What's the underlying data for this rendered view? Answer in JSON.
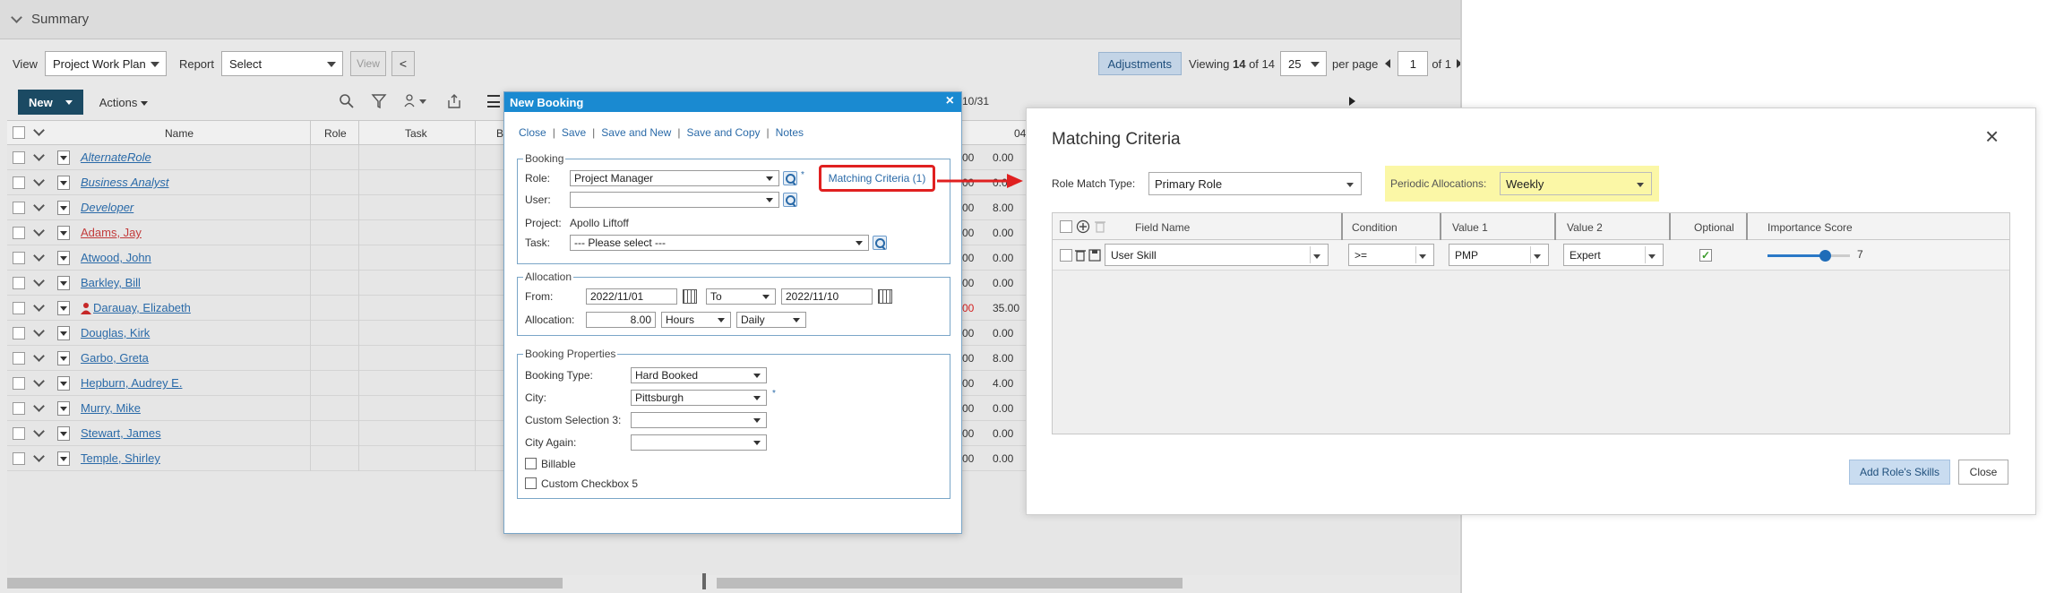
{
  "summary": {
    "label": "Summary"
  },
  "toolbar": {
    "view_label": "View",
    "view_value": "Project Work Plan",
    "report_label": "Report",
    "report_value": "Select",
    "view_button": "View",
    "adjustments": "Adjustments",
    "viewing_prefix": "Viewing",
    "viewing_count": "14",
    "viewing_of": "of 14",
    "per_page_value": "25",
    "per_page_label": "per page",
    "page_value": "1",
    "page_of": "of 1"
  },
  "toolbar2": {
    "new_label": "New",
    "actions_label": "Actions",
    "date_fragment": "10/31"
  },
  "grid": {
    "columns": {
      "name": "Name",
      "role": "Role",
      "task": "Task",
      "b": "B",
      "date": "04"
    },
    "rows": [
      {
        "name": "AlternateRole",
        "italic": true,
        "color": "#2a6aa8",
        "v1": "00",
        "v2": "0.00",
        "v1color": "#333",
        "user_icon": false
      },
      {
        "name": "Business Analyst",
        "italic": true,
        "color": "#2a6aa8",
        "v1": "00",
        "v2": "0.00",
        "v1color": "#333",
        "user_icon": false
      },
      {
        "name": "Developer",
        "italic": true,
        "color": "#2a6aa8",
        "v1": "00",
        "v2": "8.00",
        "v1color": "#333",
        "user_icon": false
      },
      {
        "name": "Adams, Jay",
        "italic": false,
        "color": "#c23b3b",
        "v1": "00",
        "v2": "0.00",
        "v1color": "#333",
        "user_icon": false
      },
      {
        "name": "Atwood, John",
        "italic": false,
        "color": "#2a6aa8",
        "v1": "00",
        "v2": "0.00",
        "v1color": "#333",
        "user_icon": false
      },
      {
        "name": "Barkley, Bill",
        "italic": false,
        "color": "#2a6aa8",
        "v1": "00",
        "v2": "0.00",
        "v1color": "#333",
        "user_icon": false
      },
      {
        "name": "Darauay, Elizabeth",
        "italic": false,
        "color": "#2a6aa8",
        "v1": "00",
        "v2": "35.00",
        "v1color": "#d42020",
        "user_icon": true
      },
      {
        "name": "Douglas, Kirk",
        "italic": false,
        "color": "#2a6aa8",
        "v1": "00",
        "v2": "0.00",
        "v1color": "#333",
        "user_icon": false
      },
      {
        "name": "Garbo, Greta",
        "italic": false,
        "color": "#2a6aa8",
        "v1": "00",
        "v2": "8.00",
        "v1color": "#333",
        "user_icon": false
      },
      {
        "name": "Hepburn, Audrey E.",
        "italic": false,
        "color": "#2a6aa8",
        "v1": "00",
        "v2": "4.00",
        "v1color": "#333",
        "user_icon": false
      },
      {
        "name": "Murry, Mike",
        "italic": false,
        "color": "#2a6aa8",
        "v1": "00",
        "v2": "0.00",
        "v1color": "#333",
        "user_icon": false
      },
      {
        "name": "Stewart, James",
        "italic": false,
        "color": "#2a6aa8",
        "v1": "00",
        "v2": "0.00",
        "v1color": "#333",
        "user_icon": false
      },
      {
        "name": "Temple, Shirley",
        "italic": false,
        "color": "#2a6aa8",
        "v1": "00",
        "v2": "0.00",
        "v1color": "#333",
        "user_icon": false
      }
    ]
  },
  "booking": {
    "title": "New Booking",
    "close_x": "×",
    "links": [
      "Close",
      "Save",
      "Save and New",
      "Save and Copy",
      "Notes"
    ],
    "section_booking": "Booking",
    "role_label": "Role:",
    "role_value": "Project Manager",
    "matching_criteria": "Matching Criteria (1)",
    "user_label": "User:",
    "user_value": "",
    "project_label": "Project:",
    "project_value": "Apollo Liftoff",
    "task_label": "Task:",
    "task_value": "--- Please select ---",
    "section_allocation": "Allocation",
    "from_label": "From:",
    "from_value": "2022/11/01",
    "to_value": "To",
    "to_date": "2022/11/10",
    "allocation_label": "Allocation:",
    "allocation_value": "8.00",
    "hours_value": "Hours",
    "daily_value": "Daily",
    "section_properties": "Booking Properties",
    "booking_type_label": "Booking Type:",
    "booking_type_value": "Hard Booked",
    "city_label": "City:",
    "city_value": "Pittsburgh",
    "custom_sel_label": "Custom Selection 3:",
    "city_again_label": "City Again:",
    "billable_label": "Billable",
    "custom_cb_label": "Custom Checkbox 5"
  },
  "matching": {
    "title": "Matching Criteria",
    "close_icon": "×",
    "role_match_label": "Role Match Type:",
    "role_match_value": "Primary Role",
    "periodic_label": "Periodic Allocations:",
    "periodic_value": "Weekly",
    "columns": [
      "Field Name",
      "Condition",
      "Value 1",
      "Value 2",
      "Optional",
      "Importance Score"
    ],
    "row": {
      "field": "User Skill",
      "condition": ">=",
      "value1": "PMP",
      "value2": "Expert",
      "optional": true,
      "score": "7",
      "score_fraction": 0.7
    },
    "add_button": "Add Role's Skills",
    "close_button": "Close",
    "highlight_color": "#fbf7a6",
    "annotation_color": "#e02020"
  }
}
